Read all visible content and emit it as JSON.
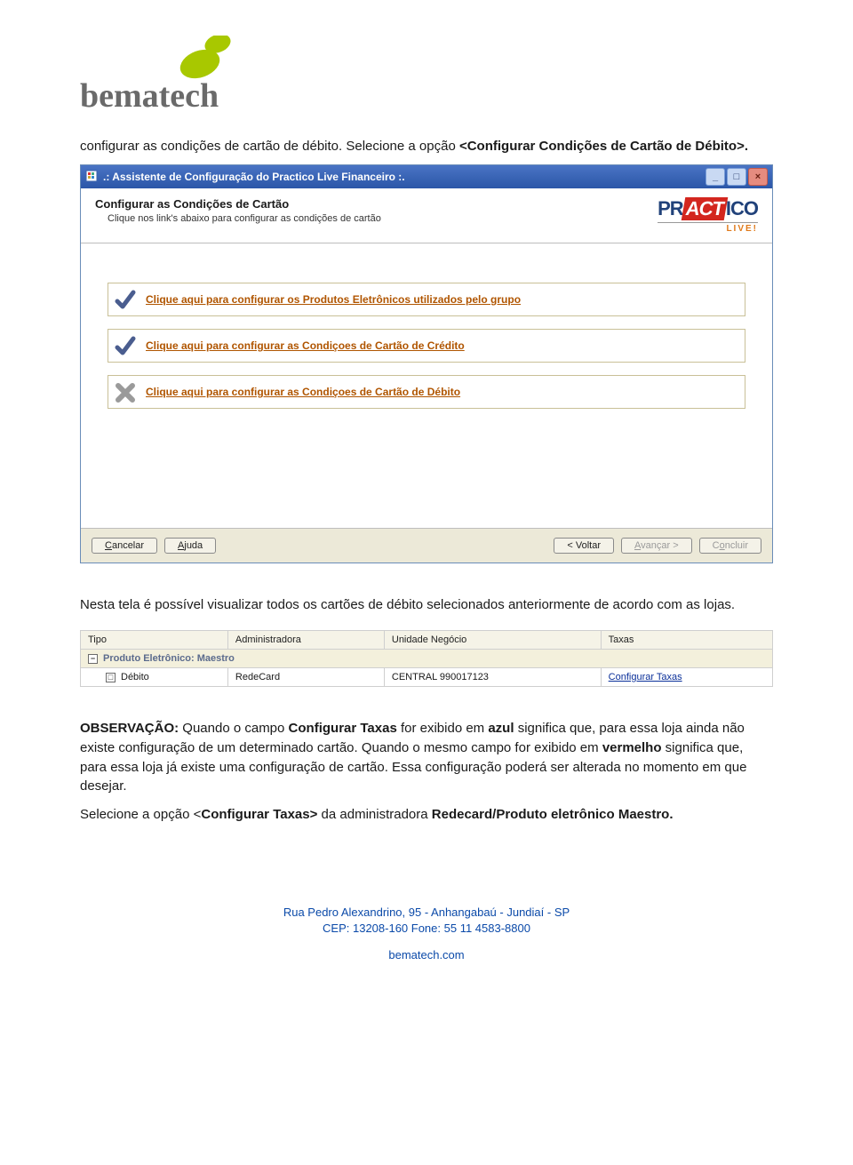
{
  "logo": {
    "text": "bematech"
  },
  "intro": {
    "line1": "configurar as condições de cartão de débito. Selecione a opção ",
    "bold": "<Configurar Condições de Cartão de Débito>.",
    "after": ""
  },
  "wizard": {
    "titlebar": ".: Assistente de Configuração do Practico Live Financeiro :.",
    "header_title": "Configurar as Condições de Cartão",
    "header_sub": "Clique nos link's abaixo para configurar as condições de cartão",
    "brand": {
      "pr": "PR",
      "act": "ACT",
      "ico": "ICO",
      "live": "LIVE!"
    },
    "links": [
      {
        "icon": "check",
        "text": "Clique aqui para configurar os Produtos Eletrônicos utilizados pelo grupo"
      },
      {
        "icon": "check",
        "text": "Clique aqui para configurar as Condiçoes de Cartão de Crédito"
      },
      {
        "icon": "cross",
        "text": "Clique aqui para configurar as Condiçoes de Cartão de Débito"
      }
    ],
    "buttons": {
      "cancel": "Cancelar",
      "help": "Ajuda",
      "back": "< Voltar",
      "next": "Avançar >",
      "finish": "Concluir"
    }
  },
  "mid_text": "Nesta tela é possível visualizar todos os cartões de débito selecionados anteriormente de acordo com as lojas.",
  "table": {
    "headers": [
      "Tipo",
      "Administradora",
      "Unidade Negócio",
      "Taxas"
    ],
    "group_label": "Produto Eletrônico: Maestro",
    "row": {
      "tipo": "Débito",
      "admin": "RedeCard",
      "unidade": "CENTRAL 990017123",
      "taxas": "Configurar Taxas"
    }
  },
  "obs": {
    "label": "OBSERVAÇÃO:",
    "part1": " Quando o campo ",
    "bold1": "Configurar Taxas",
    "part2": " for exibido em ",
    "bold2": "azul",
    "part3": " significa que, para essa loja ainda não existe configuração de um determinado cartão. Quando o mesmo campo for exibido em ",
    "bold3": "vermelho",
    "part4": " significa que, para essa loja já existe uma configuração de cartão. Essa configuração poderá ser alterada no momento em que desejar.",
    "line2a": "Selecione a opção <",
    "line2bold": "Configurar Taxas>",
    "line2b": " da administradora ",
    "line2bold2": "Redecard/Produto eletrônico Maestro."
  },
  "footer": {
    "addr": "Rua Pedro Alexandrino, 95 - Anhangabaú - Jundiaí - SP",
    "cep": "CEP: 13208-160  Fone: 55 11 4583-8800",
    "site": "bematech.com"
  }
}
